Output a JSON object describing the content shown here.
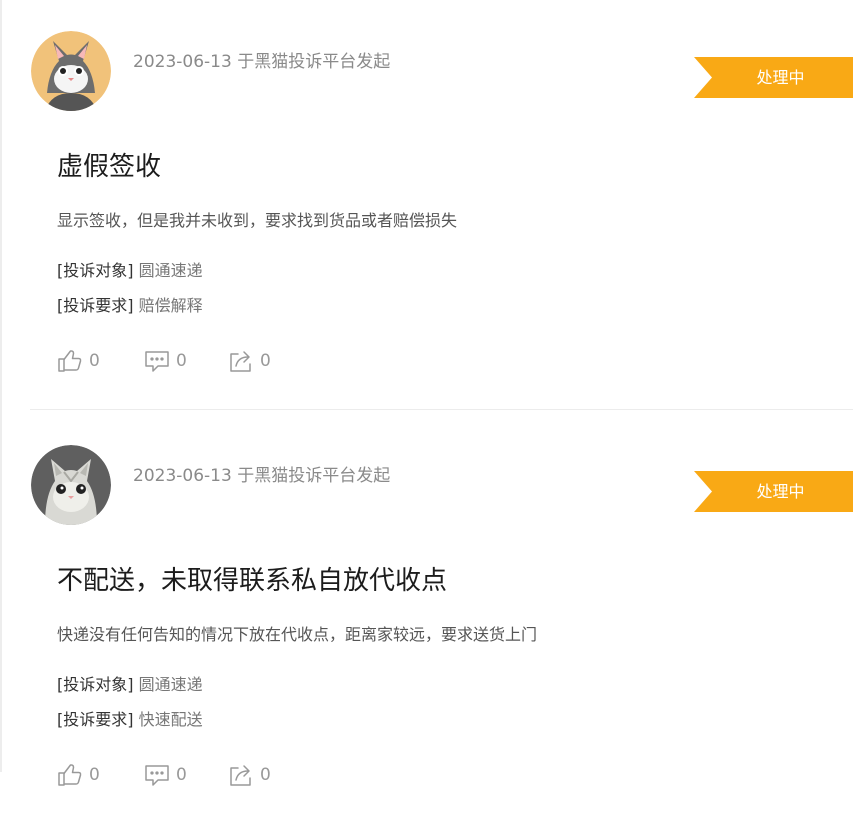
{
  "complaints": [
    {
      "date_source": "2023-06-13 于黑猫投诉平台发起",
      "status": "处理中",
      "title": "虚假签收",
      "description": "显示签收，但是我并未收到，要求找到货品或者赔偿损失",
      "target_label": "[投诉对象]",
      "target_value": "圆通速递",
      "demand_label": "[投诉要求]",
      "demand_value": "赔偿解释",
      "likes": "0",
      "comments": "0",
      "shares": "0",
      "avatar_icon": "cat-avatar-icon"
    },
    {
      "date_source": "2023-06-13 于黑猫投诉平台发起",
      "status": "处理中",
      "title": "不配送，未取得联系私自放代收点",
      "description": "快递没有任何告知的情况下放在代收点，距离家较远，要求送货上门",
      "target_label": "[投诉对象]",
      "target_value": "圆通速递",
      "demand_label": "[投诉要求]",
      "demand_value": "快速配送",
      "likes": "0",
      "comments": "0",
      "shares": "0",
      "avatar_icon": "cat-avatar-icon"
    }
  ],
  "colors": {
    "status_badge": "#f9a915",
    "meta_text": "#8a8a8a",
    "action_icon": "#999999"
  }
}
